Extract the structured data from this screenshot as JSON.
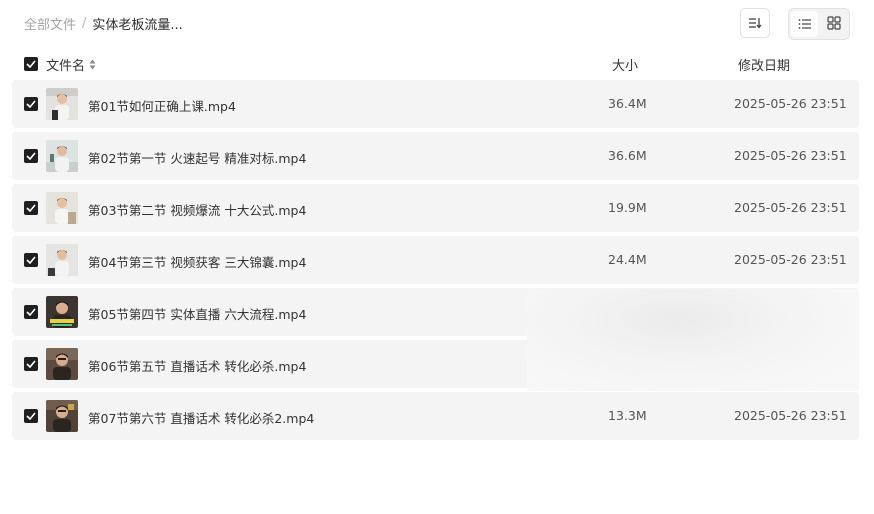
{
  "breadcrumb": {
    "root": "全部文件",
    "separator": "/",
    "current": "实体老板流量..."
  },
  "toolbar": {
    "sort_icon": "sort-icon",
    "list_view_icon": "list-view-icon",
    "grid_view_icon": "grid-view-icon",
    "active_view": "list"
  },
  "columns": {
    "name": "文件名",
    "size": "大小",
    "date": "修改日期"
  },
  "colors": {
    "row_background": "#f4f4f4",
    "checkbox": "#1f1f1f",
    "text": "#333333"
  },
  "files": [
    {
      "name": "第01节如何正确上课.mp4",
      "size": "36.4M",
      "date": "2025-05-26 23:51",
      "checked": true
    },
    {
      "name": "第02节第一节 火速起号 精准对标.mp4",
      "size": "36.6M",
      "date": "2025-05-26 23:51",
      "checked": true
    },
    {
      "name": "第03节第二节 视频爆流 十大公式.mp4",
      "size": "19.9M",
      "date": "2025-05-26 23:51",
      "checked": true
    },
    {
      "name": "第04节第三节 视频获客 三大锦囊.mp4",
      "size": "24.4M",
      "date": "2025-05-26 23:51",
      "checked": true
    },
    {
      "name": "第05节第四节 实体直播 六大流程.mp4",
      "size": "",
      "date": "",
      "checked": true
    },
    {
      "name": "第06节第五节 直播话术 转化必杀.mp4",
      "size": "",
      "date": "",
      "checked": true
    },
    {
      "name": "第07节第六节 直播话术 转化必杀2.mp4",
      "size": "13.3M",
      "date": "2025-05-26 23:51",
      "checked": true
    }
  ]
}
